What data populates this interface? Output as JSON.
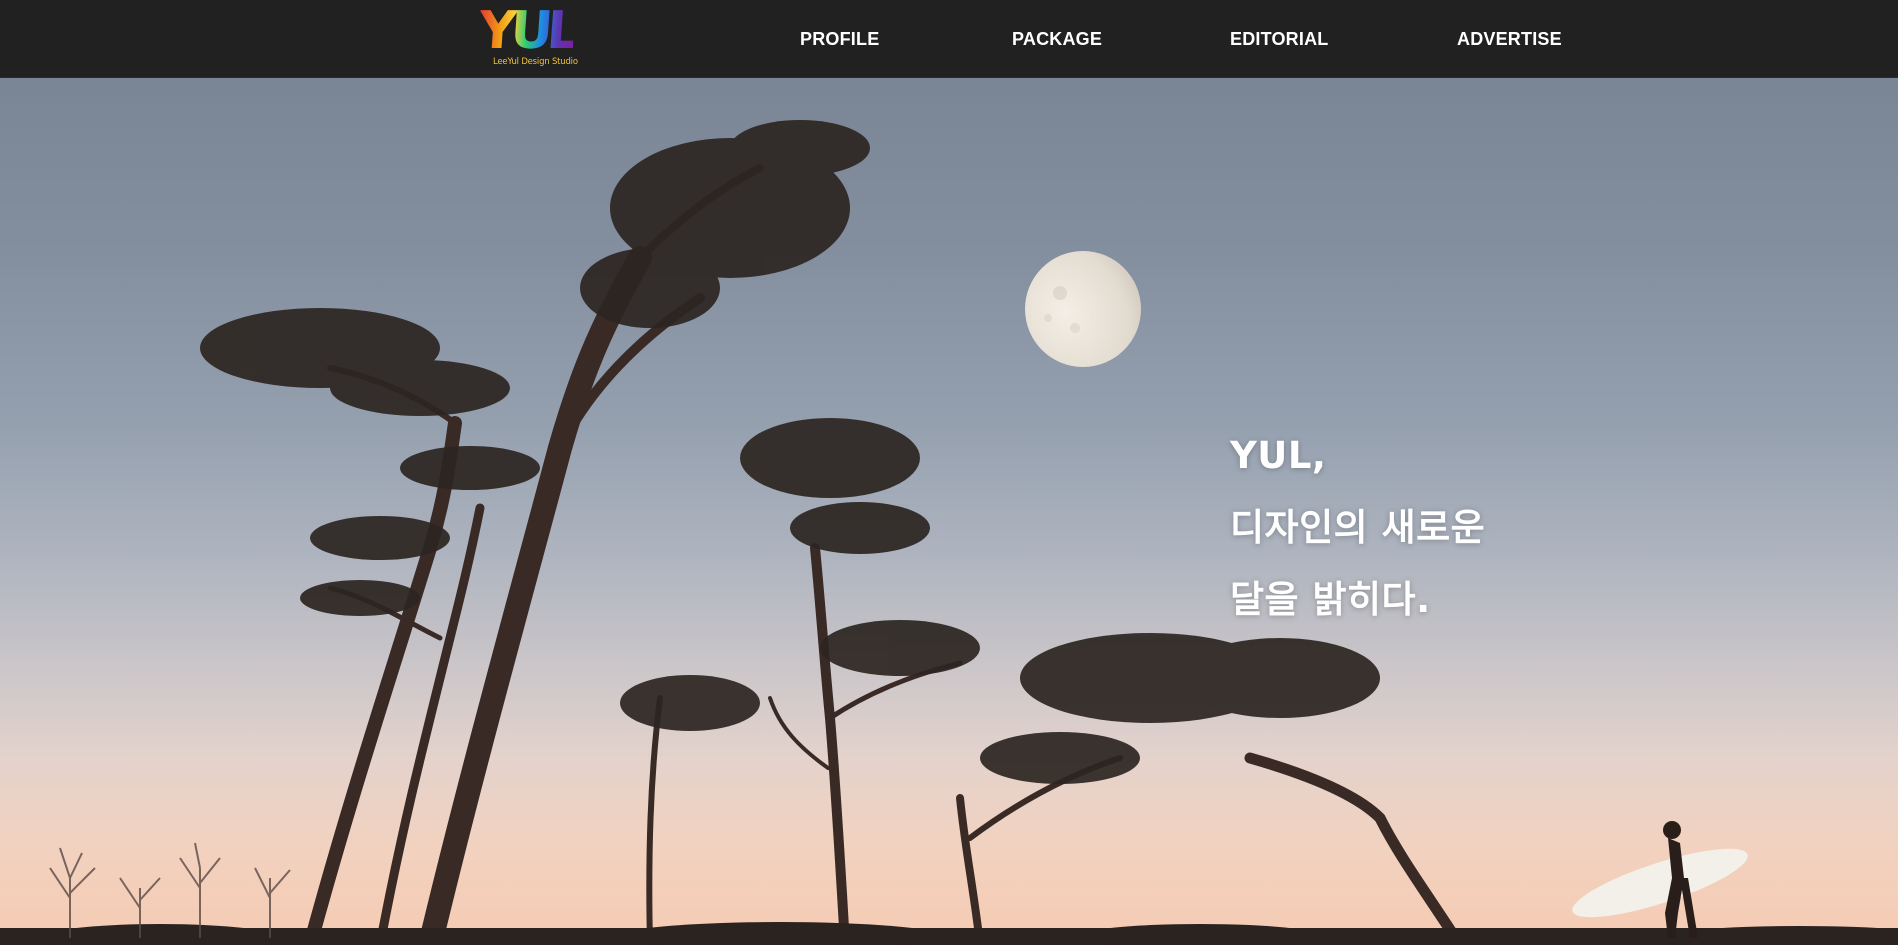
{
  "header": {
    "logo": {
      "letters": "YUL",
      "subtitle": "LeeYul Design Studio"
    },
    "nav": [
      {
        "label": "PROFILE"
      },
      {
        "label": "PACKAGE"
      },
      {
        "label": "EDITORIAL"
      },
      {
        "label": "ADVERTISE"
      }
    ]
  },
  "hero": {
    "headline": [
      "YUL,",
      "디자인의 새로운",
      "달을 밝히다."
    ],
    "image_description_icons": [
      "moon-icon",
      "pine-tree-icon",
      "surfer-icon"
    ]
  },
  "colors": {
    "header_bg": "#212121",
    "nav_text": "#ffffff",
    "headline_text": "#ffffff",
    "sky_top": "#7a8696",
    "sky_bottom": "#f6cbb3"
  }
}
